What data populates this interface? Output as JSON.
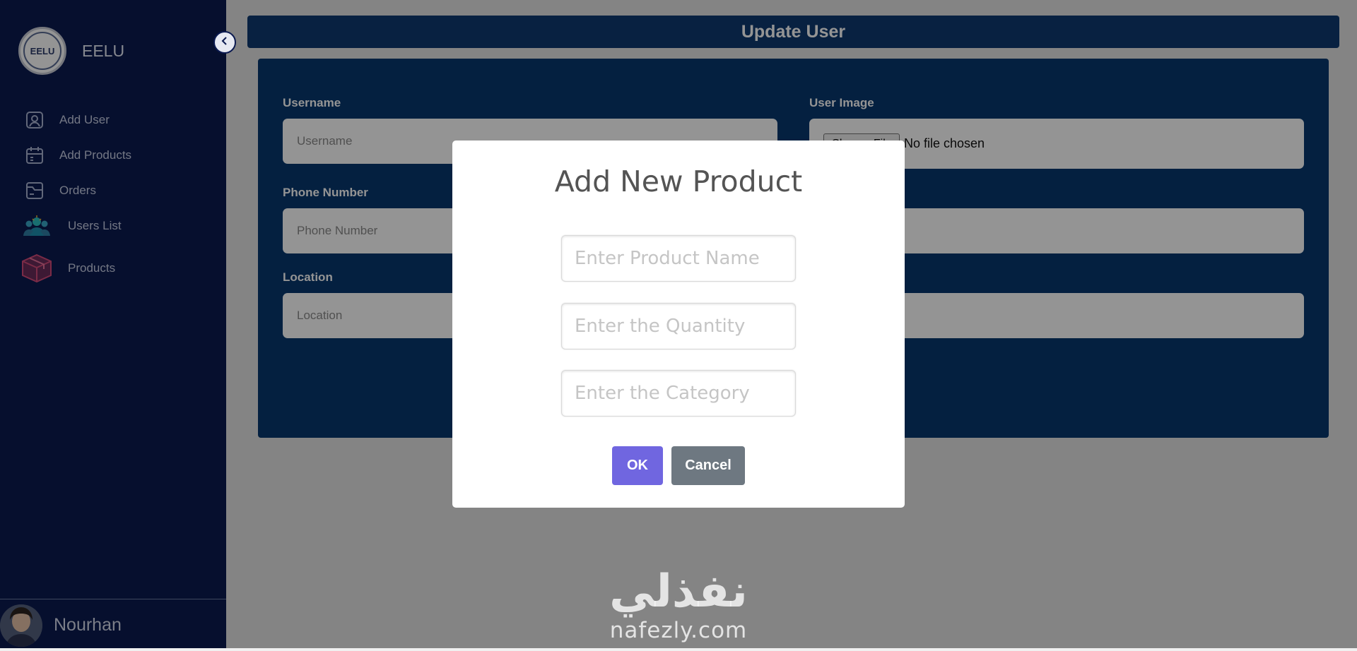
{
  "sidebar": {
    "brand": "EELU",
    "logo_text": "EELU",
    "items": [
      {
        "label": "Add User",
        "icon": "user-square-icon"
      },
      {
        "label": "Add Products",
        "icon": "calendar-icon"
      },
      {
        "label": "Orders",
        "icon": "inbox-icon"
      },
      {
        "label": "Users List",
        "icon": "users-group-icon"
      },
      {
        "label": "Products",
        "icon": "box-icon"
      }
    ],
    "user_name": "Nourhan"
  },
  "header": {
    "title": "Update User"
  },
  "form": {
    "username_label": "Username",
    "username_placeholder": "Username",
    "user_image_label": "User Image",
    "file_button": "Choose File",
    "file_status": "No file chosen",
    "phone_label": "Phone Number",
    "phone_placeholder": "Phone Number",
    "location_label": "Location",
    "location_placeholder": "Location"
  },
  "modal": {
    "title": "Add New Product",
    "product_name_placeholder": "Enter Product Name",
    "quantity_placeholder": "Enter the Quantity",
    "category_placeholder": "Enter the Category",
    "ok_label": "OK",
    "cancel_label": "Cancel"
  },
  "watermark": {
    "arabic": "نفذلي",
    "latin": "nafezly.com"
  },
  "colors": {
    "sidebar_bg": "#0b1a50",
    "header_bg": "#0e3a70",
    "card_bg": "#08376f",
    "ok_button": "#7066e0",
    "cancel_button": "#6e7881"
  }
}
